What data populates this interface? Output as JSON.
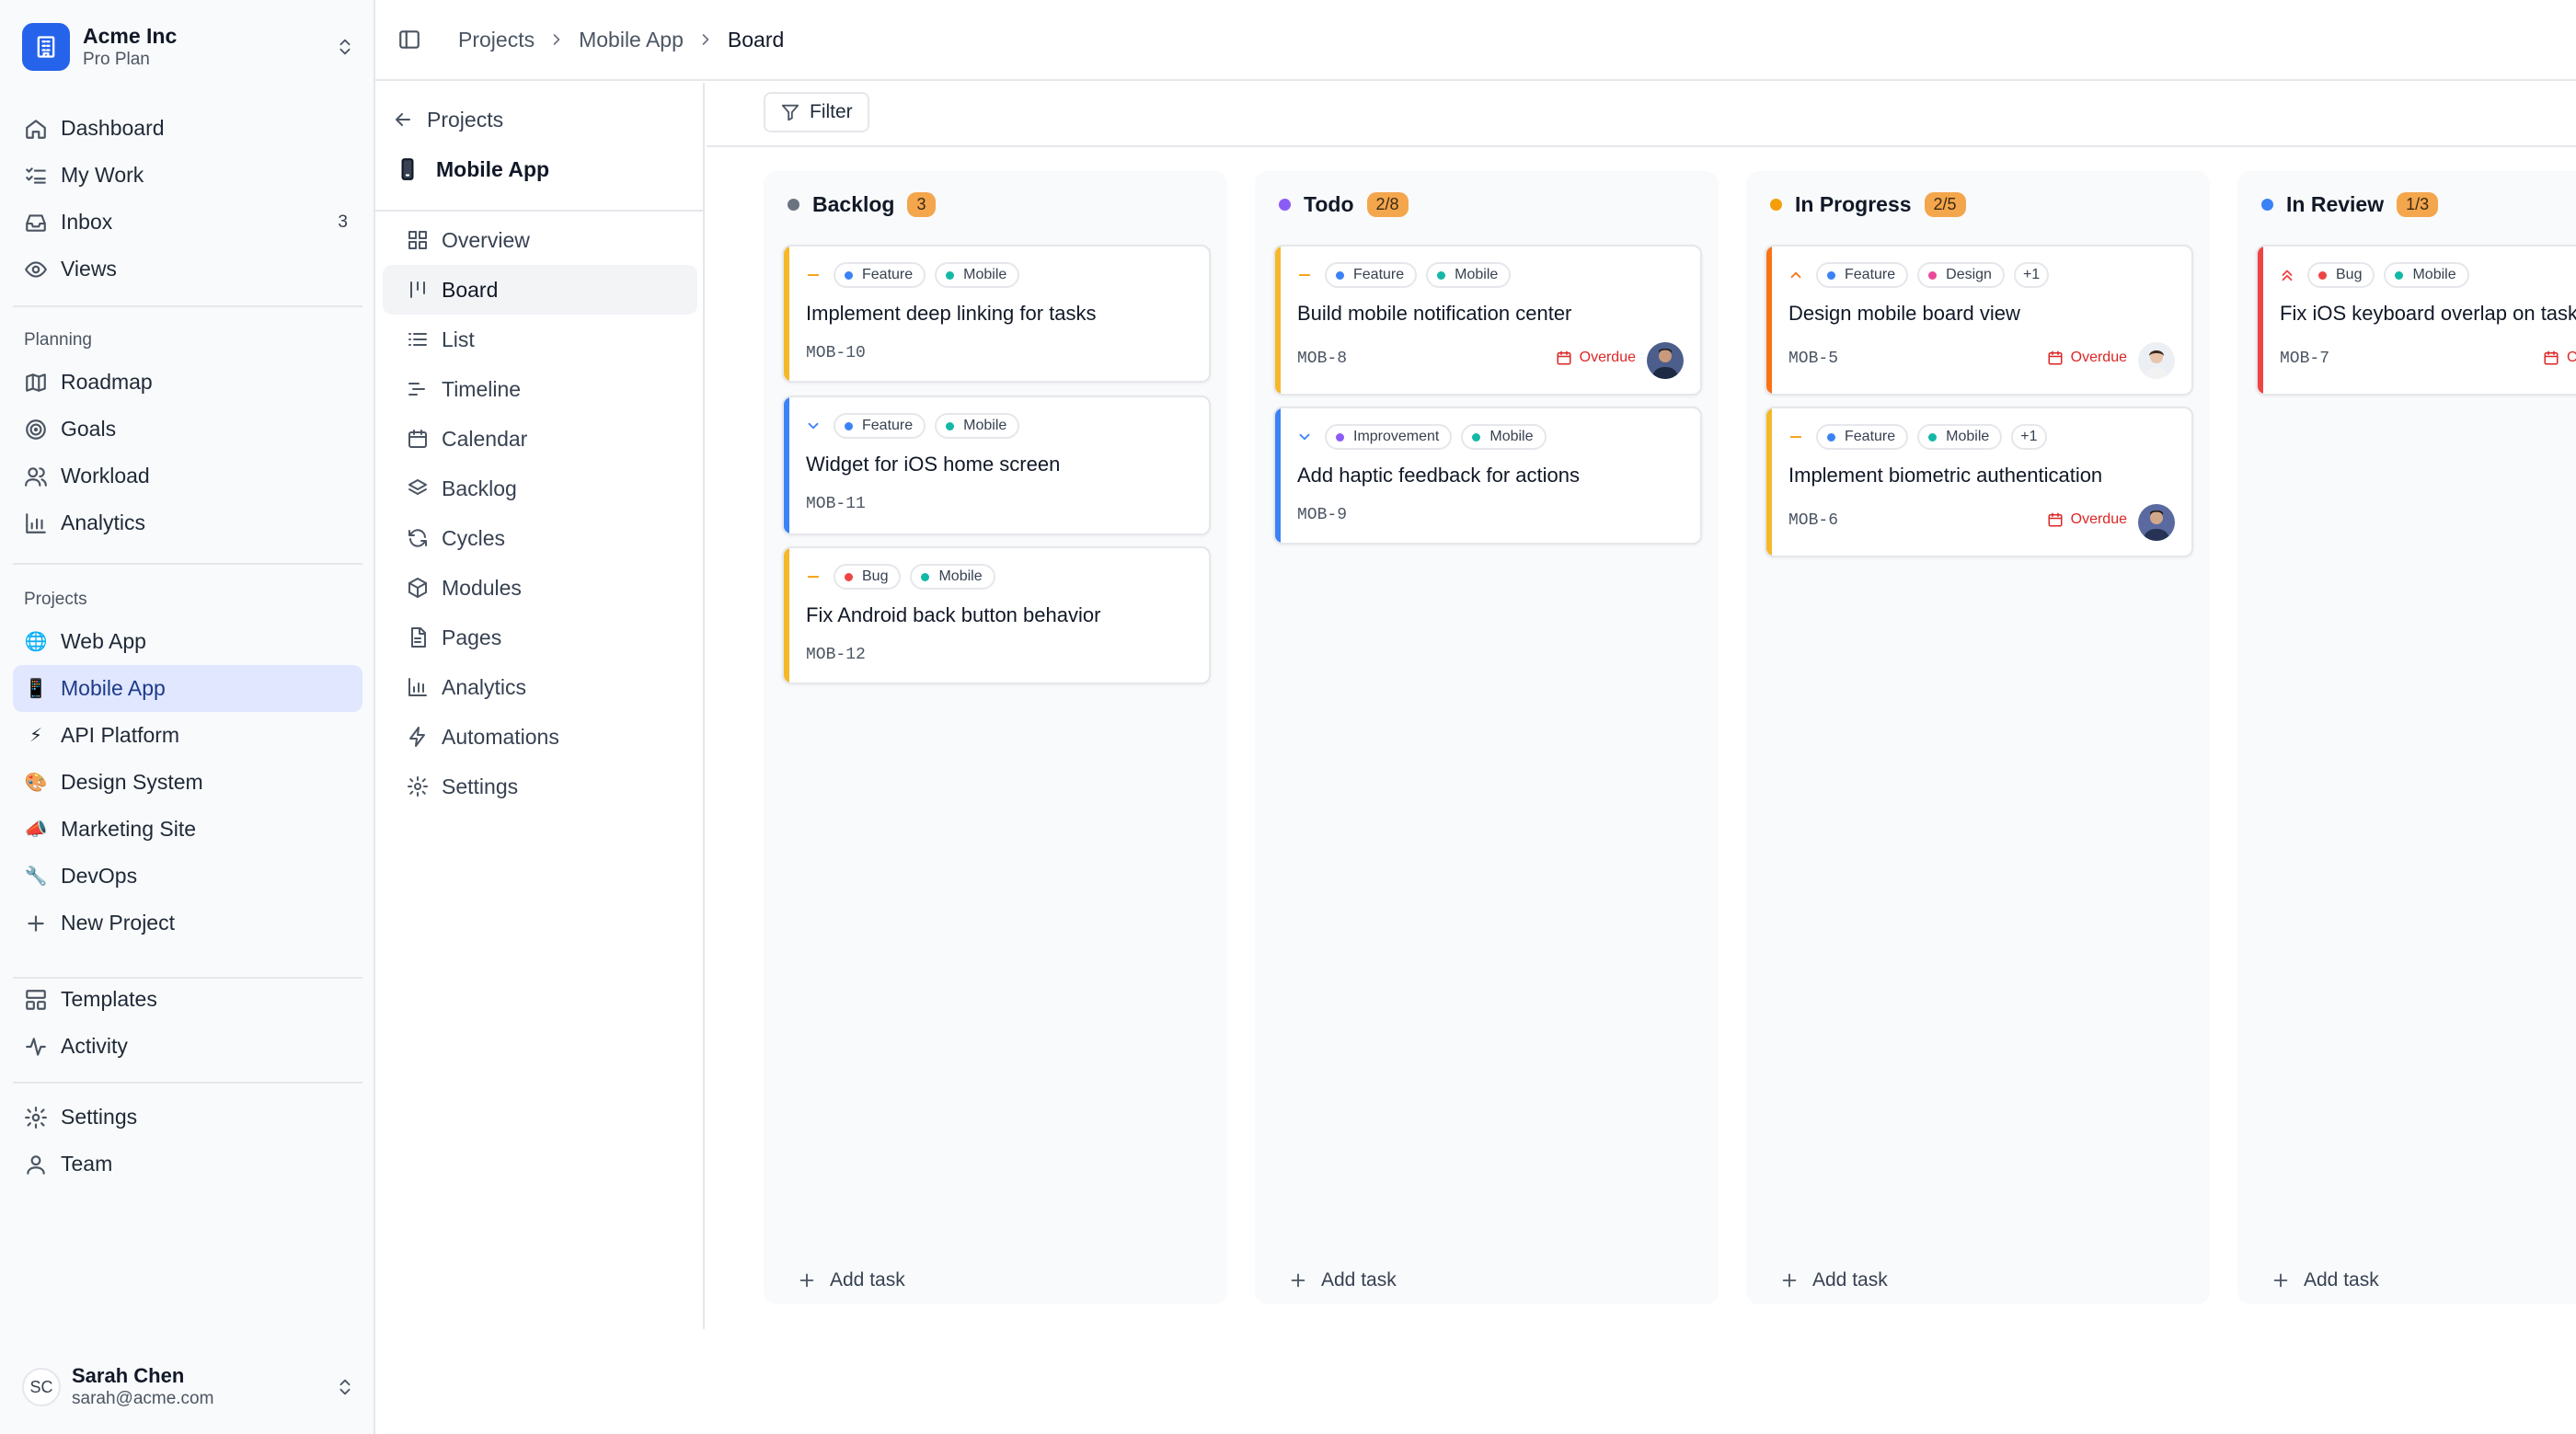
{
  "workspace": {
    "name": "Acme Inc",
    "plan": "Pro Plan"
  },
  "nav": [
    {
      "label": "Dashboard",
      "icon": "home-icon"
    },
    {
      "label": "My Work",
      "icon": "list-check-icon"
    },
    {
      "label": "Inbox",
      "icon": "inbox-icon",
      "badge": "3"
    },
    {
      "label": "Views",
      "icon": "eye-icon"
    }
  ],
  "planning": {
    "label": "Planning",
    "items": [
      {
        "label": "Roadmap",
        "icon": "map-icon"
      },
      {
        "label": "Goals",
        "icon": "target-icon"
      },
      {
        "label": "Workload",
        "icon": "users-icon"
      },
      {
        "label": "Analytics",
        "icon": "bar-chart-icon"
      }
    ]
  },
  "projects": {
    "label": "Projects",
    "items": [
      {
        "label": "Web App",
        "icon": "🌐"
      },
      {
        "label": "Mobile App",
        "icon": "📱"
      },
      {
        "label": "API Platform",
        "icon": "⚡"
      },
      {
        "label": "Design System",
        "icon": "🎨"
      },
      {
        "label": "Marketing Site",
        "icon": "📣"
      },
      {
        "label": "DevOps",
        "icon": "🔧"
      }
    ],
    "new_label": "New Project"
  },
  "bottom_nav": [
    {
      "label": "Templates",
      "icon": "templates-icon"
    },
    {
      "label": "Activity",
      "icon": "activity-icon"
    }
  ],
  "settings_nav": [
    {
      "label": "Settings",
      "icon": "gear-icon"
    },
    {
      "label": "Team",
      "icon": "team-icon"
    }
  ],
  "user": {
    "initials": "SC",
    "name": "Sarah Chen",
    "email": "sarah@acme.com"
  },
  "breadcrumb": [
    "Projects",
    "Mobile App",
    "Board"
  ],
  "subnav": {
    "back_label": "Projects",
    "project_name": "Mobile App",
    "items": [
      {
        "label": "Overview"
      },
      {
        "label": "Board"
      },
      {
        "label": "List"
      },
      {
        "label": "Timeline"
      },
      {
        "label": "Calendar"
      },
      {
        "label": "Backlog"
      },
      {
        "label": "Cycles"
      },
      {
        "label": "Modules"
      },
      {
        "label": "Pages"
      },
      {
        "label": "Analytics"
      },
      {
        "label": "Automations"
      },
      {
        "label": "Settings"
      }
    ]
  },
  "filter_label": "Filter",
  "add_task_label": "Add task",
  "overdue_label": "Overdue",
  "colors": {
    "accent": "#2563eb",
    "backlog": "#6b7280",
    "todo": "#8b5cf6",
    "in_progress": "#f59e0b",
    "in_review": "#3b82f6",
    "feature": "#3b82f6",
    "mobile": "#14b8a6",
    "bug": "#ef4444",
    "design": "#ec4899",
    "improvement": "#8b5cf6",
    "count_badge": "#f4a64d"
  },
  "columns": [
    {
      "name": "Backlog",
      "count": "3",
      "cards": [
        {
          "title": "Implement deep linking for tasks",
          "key": "MOB-10",
          "priority": "medium",
          "tags": [
            {
              "label": "Feature"
            },
            {
              "label": "Mobile"
            }
          ]
        },
        {
          "title": "Widget for iOS home screen",
          "key": "MOB-11",
          "priority": "low",
          "tags": [
            {
              "label": "Feature"
            },
            {
              "label": "Mobile"
            }
          ]
        },
        {
          "title": "Fix Android back button behavior",
          "key": "MOB-12",
          "priority": "medium",
          "tags": [
            {
              "label": "Bug"
            },
            {
              "label": "Mobile"
            }
          ]
        }
      ]
    },
    {
      "name": "Todo",
      "count": "2/8",
      "cards": [
        {
          "title": "Build mobile notification center",
          "key": "MOB-8",
          "priority": "medium",
          "overdue": true,
          "tags": [
            {
              "label": "Feature"
            },
            {
              "label": "Mobile"
            }
          ]
        },
        {
          "title": "Add haptic feedback for actions",
          "key": "MOB-9",
          "priority": "low",
          "tags": [
            {
              "label": "Improvement"
            },
            {
              "label": "Mobile"
            }
          ]
        }
      ]
    },
    {
      "name": "In Progress",
      "count": "2/5",
      "cards": [
        {
          "title": "Design mobile board view",
          "key": "MOB-5",
          "priority": "high",
          "overdue": true,
          "tags": [
            {
              "label": "Feature"
            },
            {
              "label": "Design"
            },
            {
              "label": "+1"
            }
          ]
        },
        {
          "title": "Implement biometric authentication",
          "key": "MOB-6",
          "priority": "medium",
          "overdue": true,
          "tags": [
            {
              "label": "Feature"
            },
            {
              "label": "Mobile"
            },
            {
              "label": "+1"
            }
          ]
        }
      ]
    },
    {
      "name": "In Review",
      "count": "1/3",
      "cards": [
        {
          "title": "Fix iOS keyboard overlap on tasks",
          "key": "MOB-7",
          "priority": "urgent",
          "overdue": true,
          "tags": [
            {
              "label": "Bug"
            },
            {
              "label": "Mobile"
            }
          ]
        }
      ]
    }
  ]
}
